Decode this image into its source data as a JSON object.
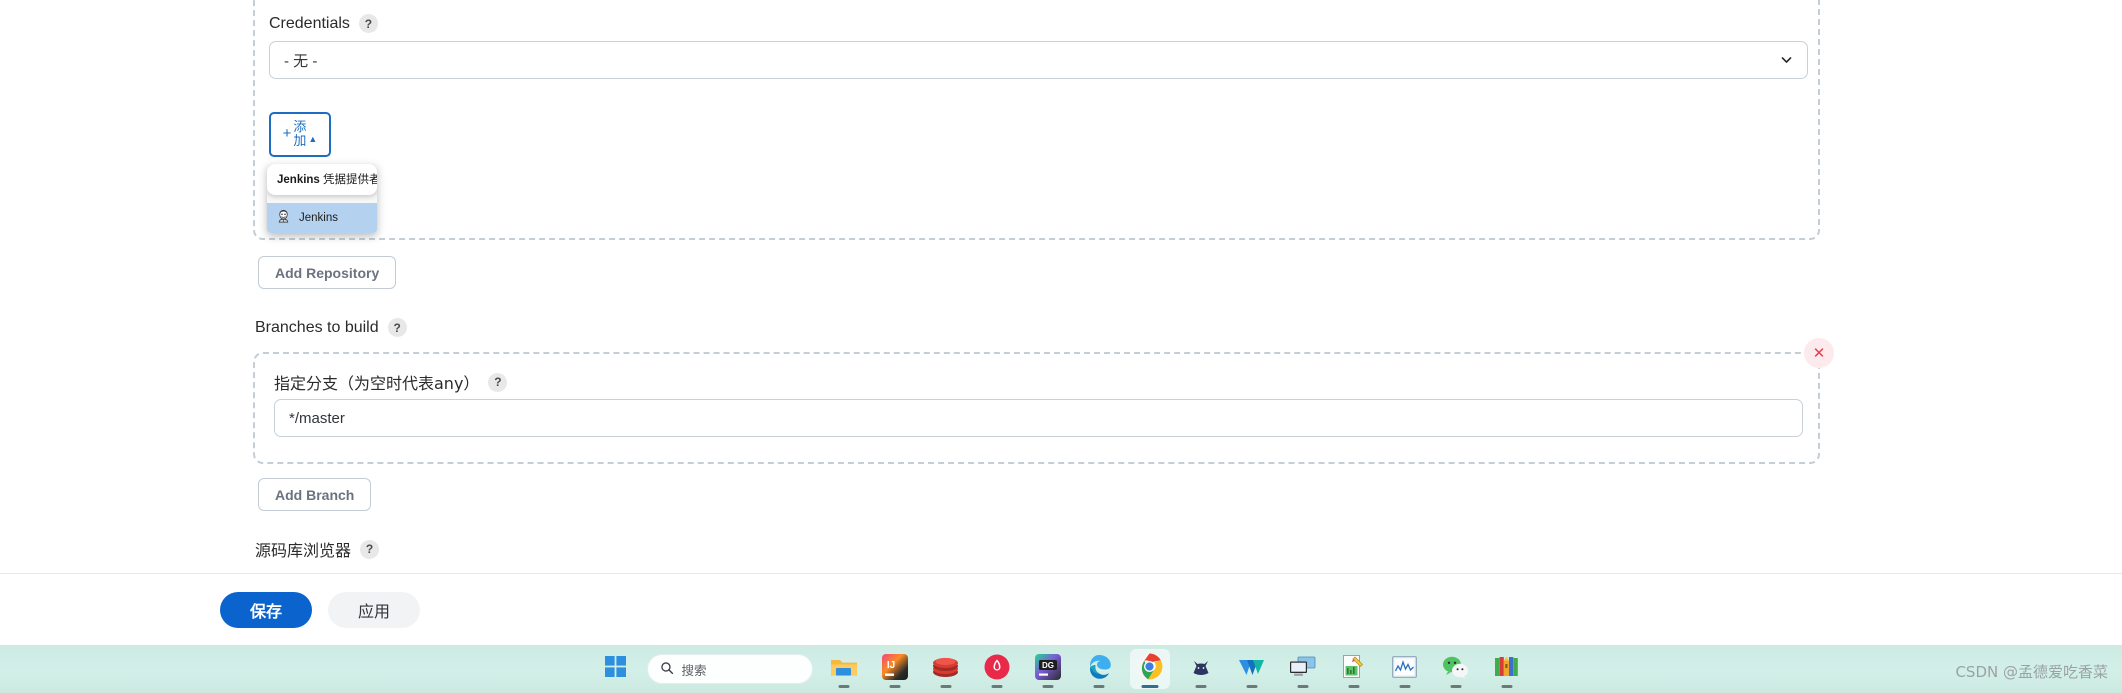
{
  "form": {
    "credentials": {
      "label": "Credentials",
      "help": "?",
      "selected": "- 无 -",
      "chevron_icon": "chevron-down-icon"
    },
    "add_button": {
      "plus": "+",
      "label_line1": "添",
      "label_line2": "加",
      "caret": "▲"
    },
    "credential_popup": {
      "header": "Jenkins 凭据提供者",
      "header_bold": "Jenkins",
      "header_rest": " 凭据提供者",
      "items": [
        {
          "label": "Jenkins",
          "icon": "jenkins-butler-icon"
        }
      ]
    },
    "add_repository_label": "Add Repository",
    "branches_to_build": {
      "label": "Branches to build",
      "help": "?"
    },
    "branch_spec": {
      "label": "指定分支（为空时代表any）",
      "help": "?",
      "value": "*/master",
      "delete_icon": "close-icon"
    },
    "add_branch_label": "Add Branch",
    "repo_browser": {
      "label": "源码库浏览器",
      "help": "?"
    }
  },
  "action_bar": {
    "save_label": "保存",
    "apply_label": "应用"
  },
  "taskbar": {
    "start_icon": "windows-start-icon",
    "search": {
      "icon": "search-icon",
      "placeholder": "搜索"
    },
    "apps": [
      {
        "name": "file-explorer-icon",
        "label": "文件资源管理器",
        "active": false
      },
      {
        "name": "intellij-idea-icon",
        "label": "IntelliJ IDEA",
        "active": false
      },
      {
        "name": "redis-icon",
        "label": "Redis",
        "active": false
      },
      {
        "name": "firefox-dev-icon",
        "label": "Firefox",
        "active": false
      },
      {
        "name": "datagrip-icon",
        "label": "DataGrip",
        "active": false
      },
      {
        "name": "microsoft-edge-icon",
        "label": "Microsoft Edge",
        "active": false
      },
      {
        "name": "google-chrome-icon",
        "label": "Google Chrome",
        "active": true
      },
      {
        "name": "navicat-cat-icon",
        "label": "Navicat",
        "active": false
      },
      {
        "name": "wps-icon",
        "label": "WPS",
        "active": false
      },
      {
        "name": "remote-desktop-icon",
        "label": "远程桌面",
        "active": false
      },
      {
        "name": "notepad-editor-icon",
        "label": "编辑器",
        "active": false
      },
      {
        "name": "monitor-chart-icon",
        "label": "监控",
        "active": false
      },
      {
        "name": "wechat-icon",
        "label": "微信",
        "active": false
      },
      {
        "name": "winrar-icon",
        "label": "WinRAR",
        "active": false
      }
    ]
  },
  "watermark": {
    "text": "CSDN @孟德爱吃香菜"
  },
  "colors": {
    "primary_blue": "#0b64ce",
    "add_button_blue": "#1b6ec2",
    "popup_highlight": "#b4d2f0",
    "dashed_border": "#c5ced6",
    "delete_red": "#e5404c",
    "taskbar_bg": "#cfece5"
  }
}
